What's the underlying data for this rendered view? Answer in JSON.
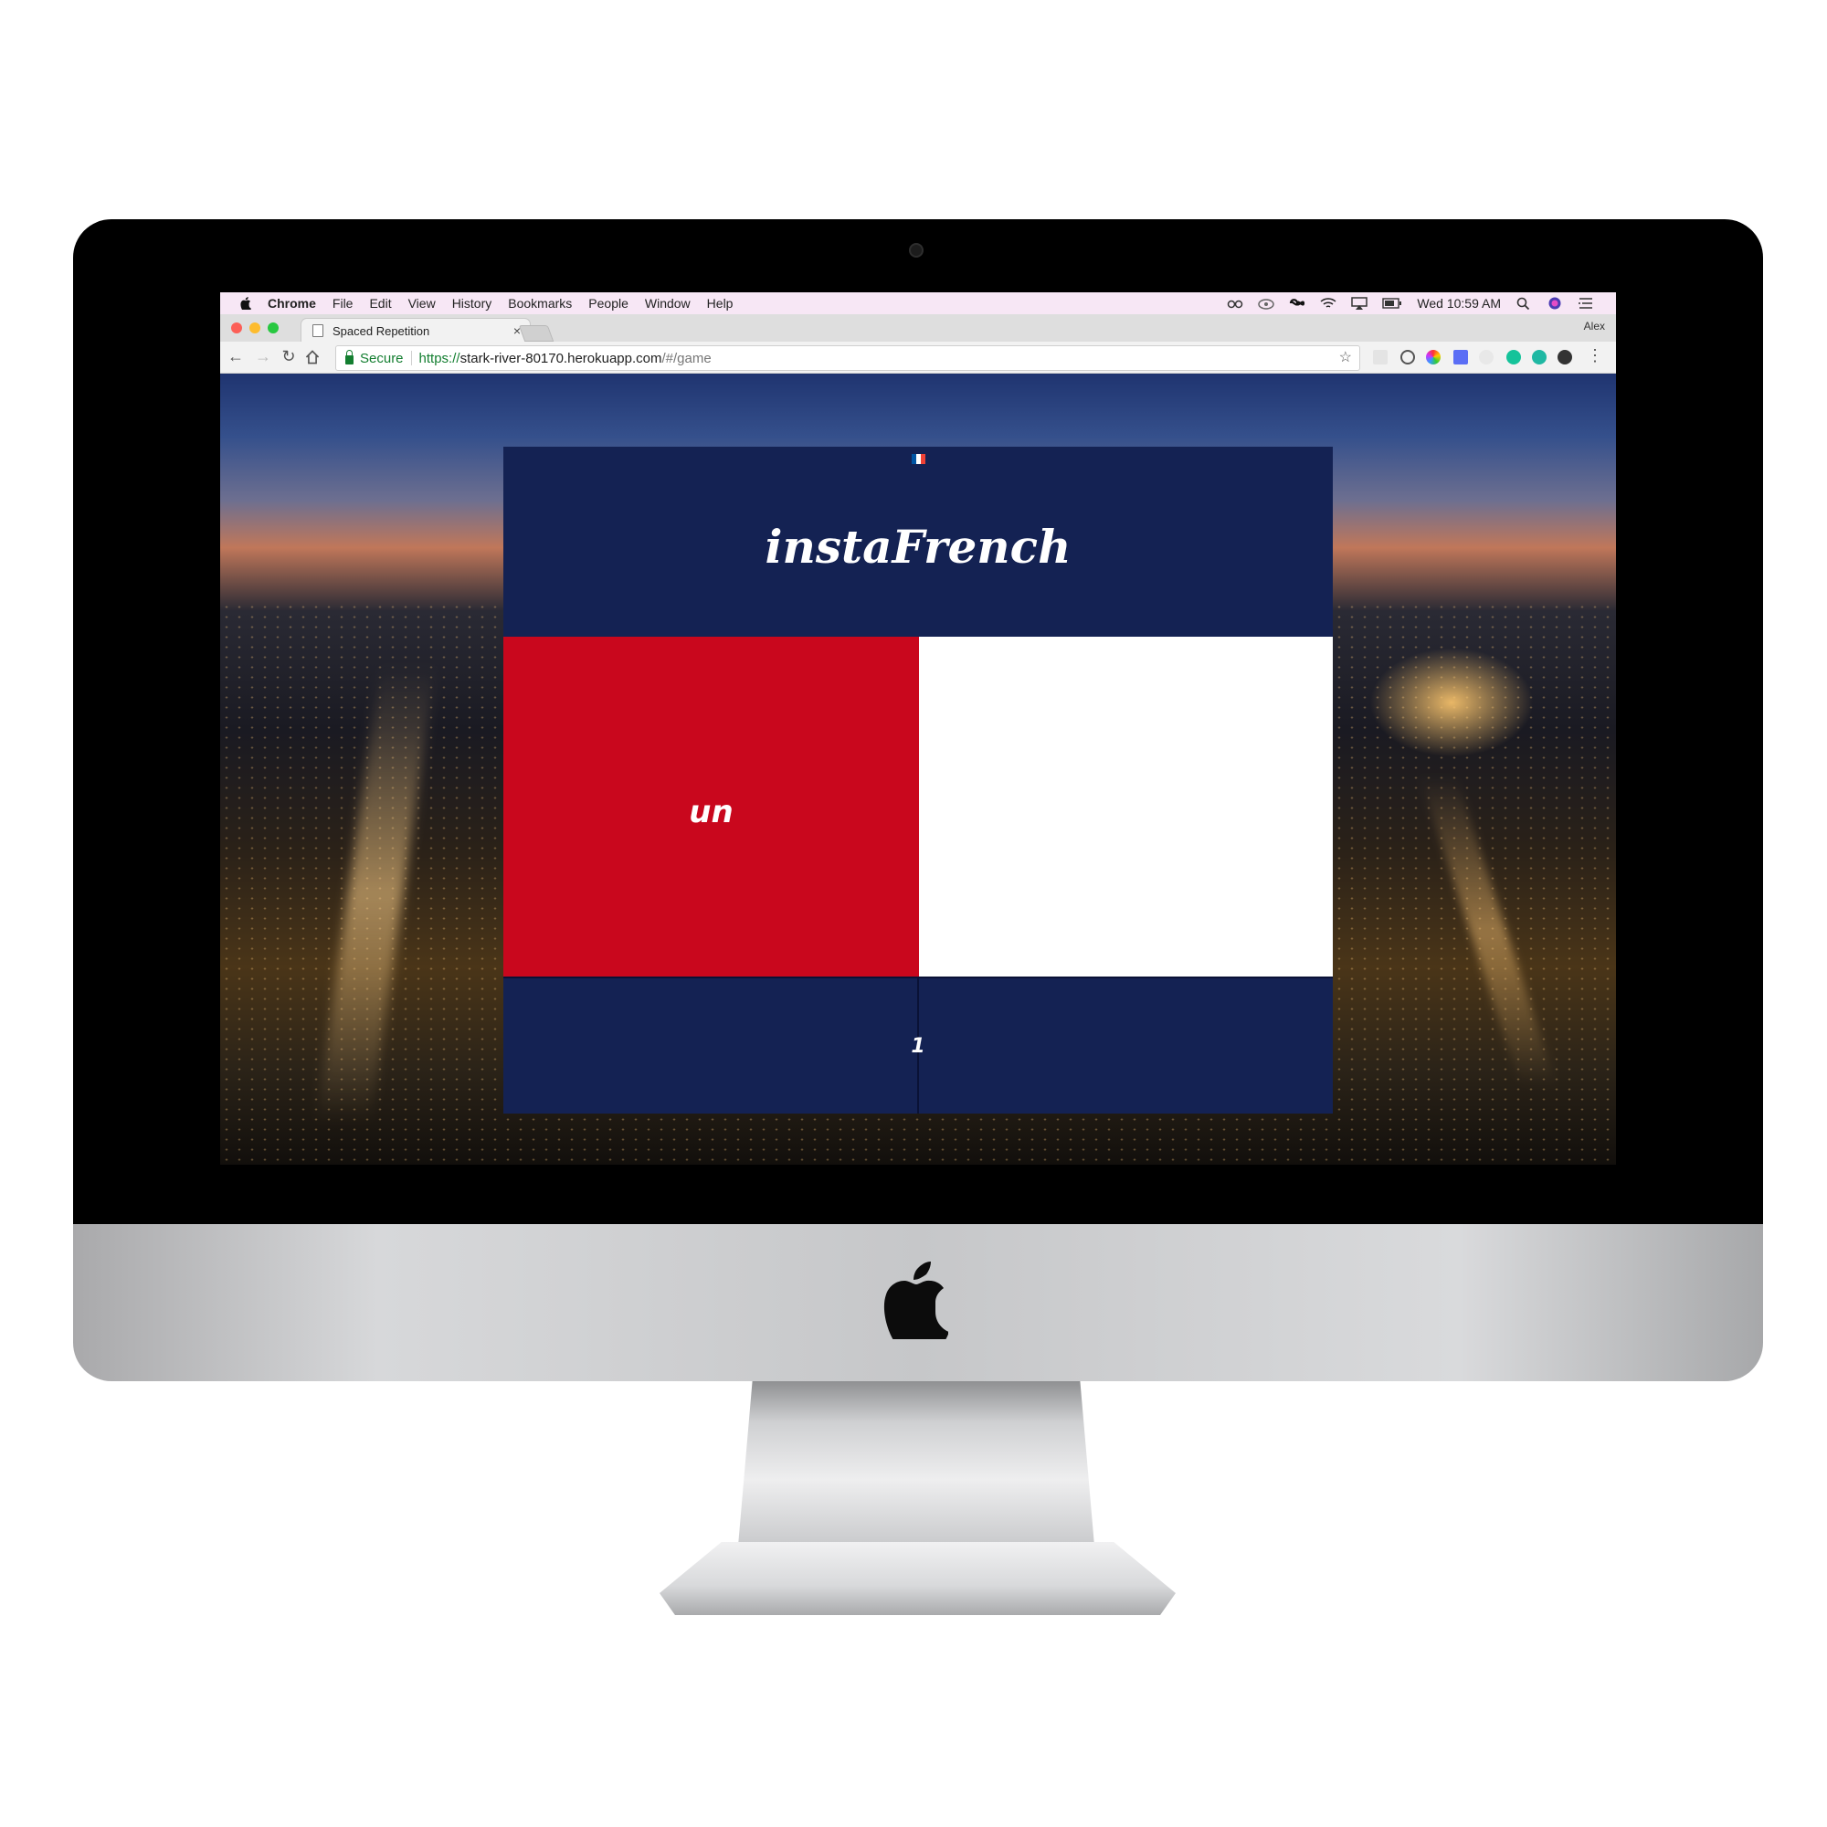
{
  "menubar": {
    "app_name": "Chrome",
    "menus": [
      "File",
      "Edit",
      "View",
      "History",
      "Bookmarks",
      "People",
      "Window",
      "Help"
    ],
    "clock": "Wed 10:59 AM"
  },
  "browser": {
    "tab_title": "Spaced Repetition",
    "tab_close": "×",
    "profile_name": "Alex",
    "secure_label": "Secure",
    "url": {
      "scheme": "https://",
      "host": "stark-river-80170.herokuapp.com",
      "path": "/#/game"
    },
    "star": "☆"
  },
  "app": {
    "title": "instaFrench",
    "flag_colors": [
      "#0055a4",
      "#ffffff",
      "#ef4135"
    ],
    "prompt_word": "un",
    "answer_value": "",
    "score": "1",
    "colors": {
      "navy": "#142253",
      "red": "#c9071d",
      "white": "#ffffff"
    }
  }
}
